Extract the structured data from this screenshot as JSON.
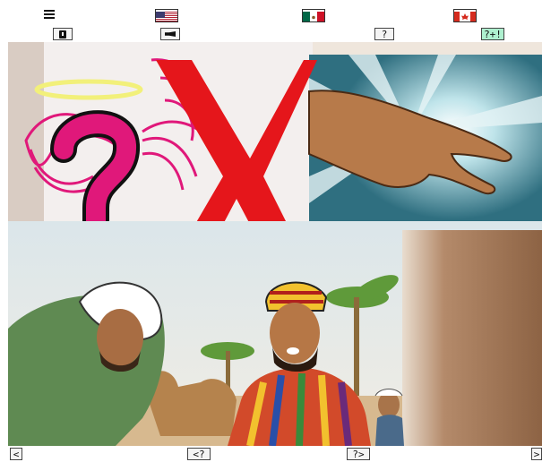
{
  "toolbar": {
    "menu_icon": "hamburger-menu-icon",
    "languages": [
      {
        "name": "english",
        "icon": "us-flag-icon"
      },
      {
        "name": "spanish",
        "icon": "mexico-flag-icon"
      },
      {
        "name": "french",
        "icon": "canada-flag-icon"
      }
    ],
    "book_icon": "book-icon",
    "audio_icon": "speaker-icon",
    "help_label": "?",
    "help_plus_label": "?+!",
    "help_plus_color": "#aef0cf"
  },
  "scene": {
    "panels": [
      "angel-question-panel",
      "divine-hand-panel",
      "jesus-and-disciple-panel"
    ],
    "x_mark_color": "#e5161b",
    "question_mark_color": "#e0187a",
    "halo_color": "#f2f07a"
  },
  "navigation": {
    "prev_label": "<",
    "prev_question_label": "<?",
    "next_question_label": "?>",
    "next_label": ">"
  }
}
